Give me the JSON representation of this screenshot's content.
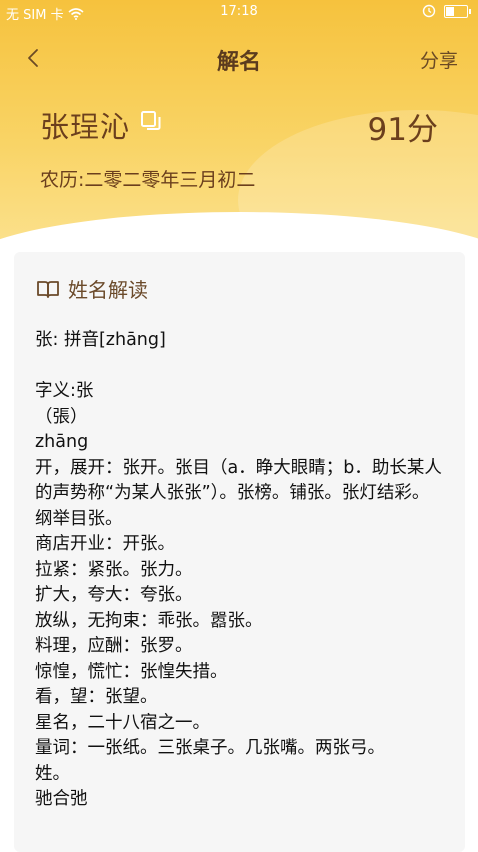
{
  "status_bar": {
    "carrier": "无 SIM 卡",
    "time": "17:18"
  },
  "nav": {
    "title": "解名",
    "share_label": "分享"
  },
  "profile": {
    "name": "张珵沁",
    "score": "91分",
    "lunar_date": "农历:二零二零年三月初二"
  },
  "card": {
    "title": "姓名解读",
    "lines": [
      "张: 拼音[zhāng]",
      "",
      "字义:张",
      "（張）",
      "zhāng",
      "开，展开：张开。张目（a．睁大眼睛；b．助长某人的声势称“为某人张张”）。张榜。铺张。张灯结彩。纲举目张。",
      "商店开业：开张。",
      "拉紧：紧张。张力。",
      "扩大，夸大：夸张。",
      "放纵，无拘束：乖张。嚣张。",
      "料理，应酬：张罗。",
      "惊惶，慌忙：张惶失措。",
      "看，望：张望。",
      "星名，二十八宿之一。",
      "量词：一张纸。三张桌子。几张嘴。两张弓。",
      "姓。",
      "驰合弛"
    ]
  },
  "colors": {
    "header_gradient_top": "#f6c23d",
    "header_gradient_bottom": "#fbe08a",
    "title_brown": "#5b3b1e",
    "card_bg": "#f6f6f6"
  },
  "icons": {
    "back": "chevron-left-icon",
    "copy": "copy-icon",
    "book": "book-icon",
    "wifi": "wifi-icon",
    "battery": "battery-icon",
    "alarm": "alarm-icon"
  }
}
